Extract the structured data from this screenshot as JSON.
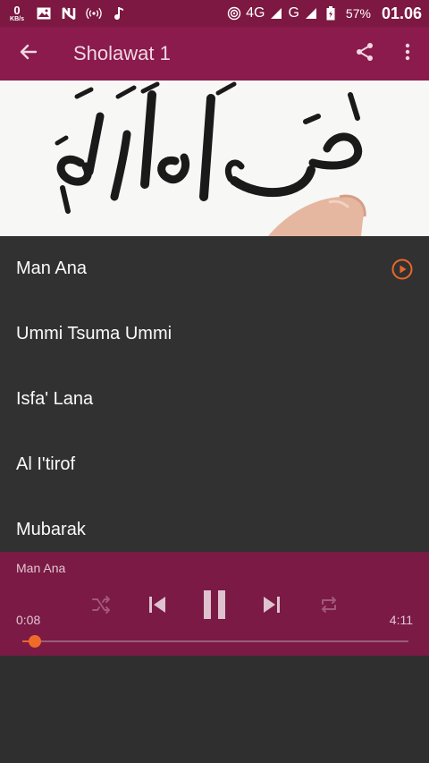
{
  "status_bar": {
    "net_speed_value": "0",
    "net_speed_unit": "KB/s",
    "icons_left": [
      "image-icon",
      "n-icon",
      "hotspot-icon",
      "music-note-icon"
    ],
    "network_label_1": "4G",
    "network_label_2": "G",
    "battery_percent": "57%",
    "time": "01.06"
  },
  "app_bar": {
    "title": "Sholawat 1",
    "actions": [
      "share-icon",
      "more-vert-icon"
    ]
  },
  "playlist": {
    "items": [
      {
        "label": "Man Ana",
        "playing": true
      },
      {
        "label": "Ummi Tsuma Ummi",
        "playing": false
      },
      {
        "label": "Isfa' Lana",
        "playing": false
      },
      {
        "label": "Al I'tirof",
        "playing": false
      },
      {
        "label": "Mubarak",
        "playing": false
      }
    ]
  },
  "player": {
    "now_playing": "Man Ana",
    "current_time": "0:08",
    "duration": "4:11",
    "progress": 0.032,
    "controls": [
      "shuffle-icon",
      "skip-previous-icon",
      "pause-icon",
      "skip-next-icon",
      "repeat-icon"
    ]
  },
  "colors": {
    "status_bar": "#7c1841",
    "app_bar": "#8a1b4c",
    "player": "#7a1a45",
    "list_bg": "#313131",
    "accent": "#e8672a"
  }
}
